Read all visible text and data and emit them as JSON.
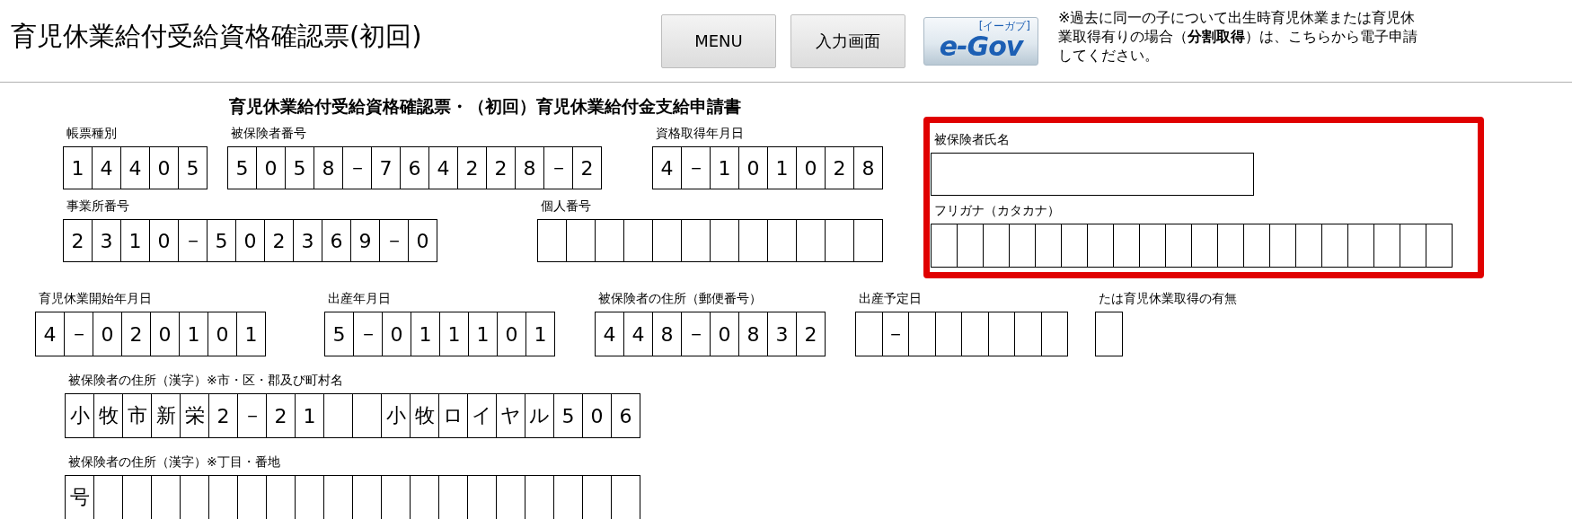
{
  "header": {
    "title": "育児休業給付受給資格確認票(初回)",
    "buttons": [
      {
        "label": "MENU"
      },
      {
        "label": "入力画面"
      }
    ],
    "logo": {
      "text": "e-Gov",
      "reading": "[イーガブ]"
    },
    "note": "※過去に同一の子について出生時育児休業または育児休業取得有りの場合（**分割取得**）は、こちらから電子申請してください。"
  },
  "form": {
    "title": "育児休業給付受給資格確認票・（初回）育児休業給付金支給申請書",
    "top_rows": [
      [
        {
          "label": "帳票種別",
          "cells": [
            {
              "kind": "char",
              "text": "1"
            },
            {
              "kind": "char",
              "text": "4"
            },
            {
              "kind": "char",
              "text": "4"
            },
            {
              "kind": "char",
              "text": "0"
            },
            {
              "kind": "char",
              "text": "5"
            }
          ]
        },
        {
          "label": "被保険者番号",
          "cells": [
            {
              "kind": "char",
              "text": "5"
            },
            {
              "kind": "char",
              "text": "0"
            },
            {
              "kind": "char",
              "text": "5"
            },
            {
              "kind": "char",
              "text": "8"
            },
            {
              "kind": "char",
              "text": "－"
            },
            {
              "kind": "char",
              "text": "7"
            },
            {
              "kind": "char",
              "text": "6"
            },
            {
              "kind": "char",
              "text": "4"
            },
            {
              "kind": "char",
              "text": "2"
            },
            {
              "kind": "char",
              "text": "2"
            },
            {
              "kind": "char",
              "text": "8"
            },
            {
              "kind": "char",
              "text": "－"
            },
            {
              "kind": "char",
              "text": "2"
            }
          ]
        },
        {
          "label": "資格取得年月日",
          "cells": [
            {
              "kind": "char",
              "text": "4"
            },
            {
              "kind": "char",
              "text": "－"
            },
            {
              "kind": "char",
              "text": "1"
            },
            {
              "kind": "char",
              "text": "0"
            },
            {
              "kind": "char",
              "text": "1"
            },
            {
              "kind": "char",
              "text": "0"
            },
            {
              "kind": "char",
              "text": "2"
            },
            {
              "kind": "char",
              "text": "8"
            }
          ]
        }
      ],
      [
        {
          "label": "事業所番号",
          "cells": [
            {
              "kind": "char",
              "text": "2"
            },
            {
              "kind": "char",
              "text": "3"
            },
            {
              "kind": "char",
              "text": "1"
            },
            {
              "kind": "char",
              "text": "0"
            },
            {
              "kind": "char",
              "text": "－"
            },
            {
              "kind": "char",
              "text": "5"
            },
            {
              "kind": "char",
              "text": "0"
            },
            {
              "kind": "char",
              "text": "2"
            },
            {
              "kind": "char",
              "text": "3"
            },
            {
              "kind": "char",
              "text": "6"
            },
            {
              "kind": "char",
              "text": "9"
            },
            {
              "kind": "char",
              "text": "－"
            },
            {
              "kind": "char",
              "text": "0"
            }
          ]
        },
        {
          "label": "個人番号",
          "cells": [
            {
              "kind": "blank"
            },
            {
              "kind": "blank"
            },
            {
              "kind": "blank"
            },
            {
              "kind": "blank"
            },
            {
              "kind": "blank"
            },
            {
              "kind": "blank"
            },
            {
              "kind": "blank"
            },
            {
              "kind": "blank"
            },
            {
              "kind": "blank"
            },
            {
              "kind": "blank"
            },
            {
              "kind": "blank"
            },
            {
              "kind": "blank"
            }
          ]
        }
      ]
    ],
    "name_section": {
      "highlighted": true,
      "name": {
        "label": "被保険者氏名"
      },
      "furigana": {
        "label": "フリガナ（カタカナ）",
        "cells": [
          {
            "kind": "blank"
          },
          {
            "kind": "blank"
          },
          {
            "kind": "blank"
          },
          {
            "kind": "blank"
          },
          {
            "kind": "blank"
          },
          {
            "kind": "blank"
          },
          {
            "kind": "blank"
          },
          {
            "kind": "blank"
          },
          {
            "kind": "blank"
          },
          {
            "kind": "blank"
          },
          {
            "kind": "blank"
          },
          {
            "kind": "blank"
          },
          {
            "kind": "blank"
          },
          {
            "kind": "blank"
          },
          {
            "kind": "blank"
          },
          {
            "kind": "blank"
          },
          {
            "kind": "blank"
          },
          {
            "kind": "blank"
          },
          {
            "kind": "blank"
          },
          {
            "kind": "blank"
          }
        ]
      }
    },
    "rows": [
      [
        {
          "label": "育児休業開始年月日",
          "cells": [
            {
              "kind": "char",
              "text": "4"
            },
            {
              "kind": "char",
              "text": "－"
            },
            {
              "kind": "char",
              "text": "0"
            },
            {
              "kind": "char",
              "text": "2"
            },
            {
              "kind": "char",
              "text": "0"
            },
            {
              "kind": "char",
              "text": "1"
            },
            {
              "kind": "char",
              "text": "0"
            },
            {
              "kind": "char",
              "text": "1"
            }
          ]
        },
        {
          "label": "出産年月日",
          "cells": [
            {
              "kind": "char",
              "text": "5"
            },
            {
              "kind": "char",
              "text": "－"
            },
            {
              "kind": "char",
              "text": "0"
            },
            {
              "kind": "char",
              "text": "1"
            },
            {
              "kind": "char",
              "text": "1"
            },
            {
              "kind": "char",
              "text": "1"
            },
            {
              "kind": "char",
              "text": "0"
            },
            {
              "kind": "char",
              "text": "1"
            }
          ]
        },
        {
          "label": "被保険者の住所（郵便番号）",
          "cells": [
            {
              "kind": "char",
              "text": "4"
            },
            {
              "kind": "char",
              "text": "4"
            },
            {
              "kind": "char",
              "text": "8"
            },
            {
              "kind": "char",
              "text": "－"
            },
            {
              "kind": "char",
              "text": "0"
            },
            {
              "kind": "char",
              "text": "8"
            },
            {
              "kind": "char",
              "text": "3"
            },
            {
              "kind": "char",
              "text": "2"
            }
          ]
        },
        {
          "label": "出産予定日",
          "cells": [
            {
              "kind": "blank"
            },
            {
              "kind": "char",
              "text": "－"
            },
            {
              "kind": "blank"
            },
            {
              "kind": "blank"
            },
            {
              "kind": "blank"
            },
            {
              "kind": "blank"
            },
            {
              "kind": "blank"
            },
            {
              "kind": "blank"
            }
          ]
        },
        {
          "label": "たは育児休業取得の有無",
          "cells": [
            {
              "kind": "blank"
            }
          ]
        }
      ],
      [
        {
          "label": "被保険者の住所（漢字）※市・区・郡及び町村名",
          "cells": [
            {
              "kind": "char",
              "text": "小"
            },
            {
              "kind": "char",
              "text": "牧"
            },
            {
              "kind": "char",
              "text": "市"
            },
            {
              "kind": "char",
              "text": "新"
            },
            {
              "kind": "char",
              "text": "栄"
            },
            {
              "kind": "char",
              "text": "2"
            },
            {
              "kind": "char",
              "text": "－"
            },
            {
              "kind": "char",
              "text": "2"
            },
            {
              "kind": "char",
              "text": "1"
            },
            {
              "kind": "blank"
            },
            {
              "kind": "blank"
            },
            {
              "kind": "char",
              "text": "小"
            },
            {
              "kind": "char",
              "text": "牧"
            },
            {
              "kind": "char",
              "text": "ロ"
            },
            {
              "kind": "char",
              "text": "イ"
            },
            {
              "kind": "char",
              "text": "ヤ"
            },
            {
              "kind": "char",
              "text": "ル"
            },
            {
              "kind": "char",
              "text": "5"
            },
            {
              "kind": "char",
              "text": "0"
            },
            {
              "kind": "char",
              "text": "6"
            }
          ]
        }
      ],
      [
        {
          "label": "被保険者の住所（漢字）※丁目・番地",
          "cells": [
            {
              "kind": "char",
              "text": "号"
            },
            {
              "kind": "blank"
            },
            {
              "kind": "blank"
            },
            {
              "kind": "blank"
            },
            {
              "kind": "blank"
            },
            {
              "kind": "blank"
            },
            {
              "kind": "blank"
            },
            {
              "kind": "blank"
            },
            {
              "kind": "blank"
            },
            {
              "kind": "blank"
            },
            {
              "kind": "blank"
            },
            {
              "kind": "blank"
            },
            {
              "kind": "blank"
            },
            {
              "kind": "blank"
            },
            {
              "kind": "blank"
            },
            {
              "kind": "blank"
            },
            {
              "kind": "blank"
            },
            {
              "kind": "blank"
            },
            {
              "kind": "blank"
            },
            {
              "kind": "blank"
            }
          ]
        }
      ]
    ]
  }
}
